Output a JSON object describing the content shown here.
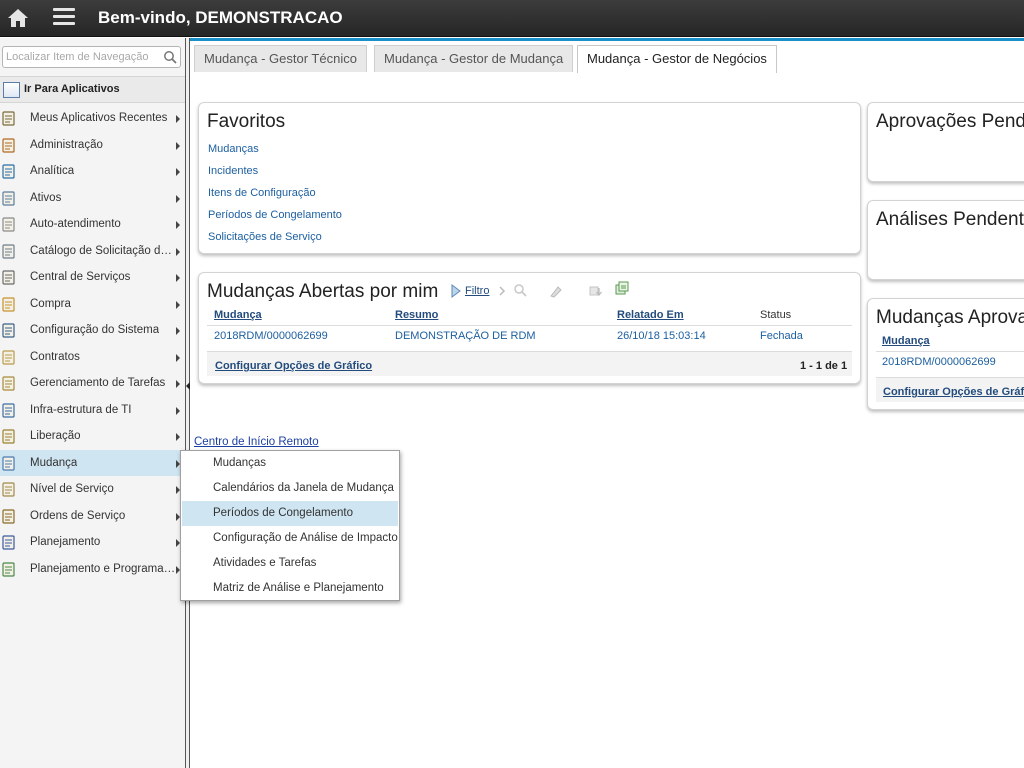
{
  "header": {
    "title": "Bem-vindo, DEMONSTRACAO"
  },
  "sidebar": {
    "search_placeholder": "Localizar Item de Navegação",
    "goto_label": "Ir Para Aplicativos",
    "items": [
      {
        "label": "Meus Aplicativos Recentes",
        "icon": "recent-apps-icon"
      },
      {
        "label": "Administração",
        "icon": "administration-icon"
      },
      {
        "label": "Analítica",
        "icon": "analytics-icon"
      },
      {
        "label": "Ativos",
        "icon": "assets-icon"
      },
      {
        "label": "Auto-atendimento",
        "icon": "self-service-icon"
      },
      {
        "label": "Catálogo de Solicitação de Serviço",
        "icon": "service-catalog-icon"
      },
      {
        "label": "Central de Serviços",
        "icon": "service-desk-icon"
      },
      {
        "label": "Compra",
        "icon": "purchasing-icon"
      },
      {
        "label": "Configuração do Sistema",
        "icon": "system-config-icon"
      },
      {
        "label": "Contratos",
        "icon": "contracts-icon"
      },
      {
        "label": "Gerenciamento de Tarefas",
        "icon": "task-management-icon"
      },
      {
        "label": "Infra-estrutura de TI",
        "icon": "it-infrastructure-icon"
      },
      {
        "label": "Liberação",
        "icon": "release-icon"
      },
      {
        "label": "Mudança",
        "icon": "change-icon"
      },
      {
        "label": "Nível de Serviço",
        "icon": "service-level-icon"
      },
      {
        "label": "Ordens de Serviço",
        "icon": "work-orders-icon"
      },
      {
        "label": "Planejamento",
        "icon": "planning-icon"
      },
      {
        "label": "Planejamento e Programação",
        "icon": "scheduling-icon"
      }
    ]
  },
  "tabs": [
    {
      "label": "Mudança - Gestor Técnico"
    },
    {
      "label": "Mudança - Gestor de Mudança"
    },
    {
      "label": "Mudança - Gestor de Negócios"
    }
  ],
  "favorites": {
    "title": "Favoritos",
    "links": [
      "Mudanças",
      "Incidentes",
      "Itens de Configuração",
      "Períodos de Congelamento",
      "Solicitações de Serviço"
    ]
  },
  "open_changes": {
    "title": "Mudanças Abertas por mim",
    "filter_label": "Filtro",
    "columns": [
      "Mudança",
      "Resumo",
      "Relatado Em",
      "Status"
    ],
    "rows": [
      [
        "2018RDM/0000062699",
        "DEMONSTRAÇÃO DE RDM",
        "26/10/18 15:03:14",
        "Fechada"
      ]
    ],
    "config_link": "Configurar Opções de Gráfico",
    "pager": "1 - 1 de 1"
  },
  "right_panels": {
    "pending_approvals": "Aprovações Pendentes",
    "pending_reviews": "Análises Pendentes",
    "approved_changes": {
      "title": "Mudanças Aprovadas",
      "column": "Mudança",
      "row": "2018RDM/0000062699",
      "config_link": "Configurar Opções de Gráfico"
    }
  },
  "remote_link": "Centro de Início Remoto",
  "submenu": {
    "items": [
      "Mudanças",
      "Calendários da Janela de Mudança",
      "Períodos de Congelamento",
      "Configuração de Análise de Impacto",
      "Atividades e Tarefas",
      "Matriz de Análise e Planejamento"
    ]
  }
}
